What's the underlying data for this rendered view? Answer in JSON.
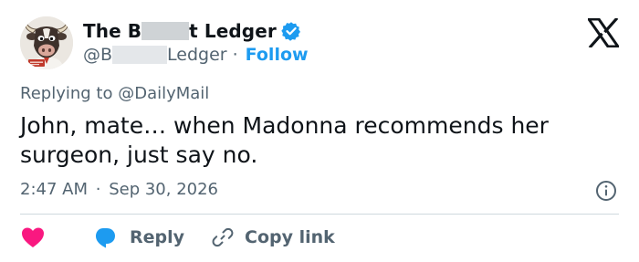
{
  "author": {
    "name_prefix": "The B",
    "name_suffix": "t Ledger",
    "handle_prefix": "@B",
    "handle_suffix": "Ledger",
    "separator": "·",
    "follow_label": "Follow"
  },
  "tweet": {
    "replying_prefix": "Replying to ",
    "replying_to": "@DailyMail",
    "text": "John, mate… when Madonna recommends her surgeon, just say no.",
    "time": "2:47 AM",
    "time_separator": "·",
    "date": "Sep 30, 2026"
  },
  "actions": {
    "reply_label": "Reply",
    "copy_link_label": "Copy link"
  },
  "colors": {
    "accent": "#1d9bf0",
    "like": "#f91880",
    "muted_text": "#536471",
    "text": "#0f1419"
  },
  "icons": [
    "verified-badge-icon",
    "x-logo-icon",
    "info-icon",
    "heart-icon",
    "reply-bubble-icon",
    "link-icon"
  ]
}
